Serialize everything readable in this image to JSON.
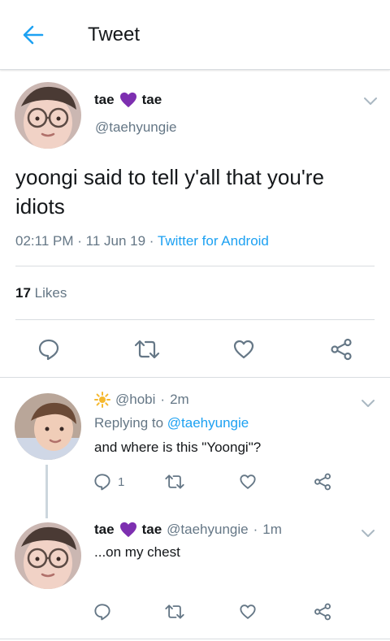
{
  "header": {
    "title": "Tweet"
  },
  "tweet": {
    "name_part1": "tae",
    "name_part2": "tae",
    "handle": "@taehyungie",
    "text": "yoongi said to tell y'all that you're idiots",
    "time": "02:11 PM",
    "date": "11 Jun 19",
    "source": "Twitter for Android",
    "likes_count": "17",
    "likes_label": "Likes"
  },
  "reply1": {
    "handle": "@hobi",
    "time": "2m",
    "replying_to_label": "Replying to",
    "replying_to_handle": "@taehyungie",
    "text": "and where is this \"Yoongi\"?",
    "reply_count": "1"
  },
  "reply2": {
    "name_part1": "tae",
    "name_part2": "tae",
    "handle": "@taehyungie",
    "time": "1m",
    "text": "...on my chest"
  },
  "colors": {
    "accent": "#1da1f2",
    "muted": "#657786",
    "purple_heart": "#7d2fb0",
    "sun": "#f5b82e"
  },
  "icons": [
    "back-arrow-icon",
    "chevron-down-icon",
    "reply-icon",
    "retweet-icon",
    "like-icon",
    "share-icon",
    "purple-heart-icon",
    "sun-icon"
  ]
}
